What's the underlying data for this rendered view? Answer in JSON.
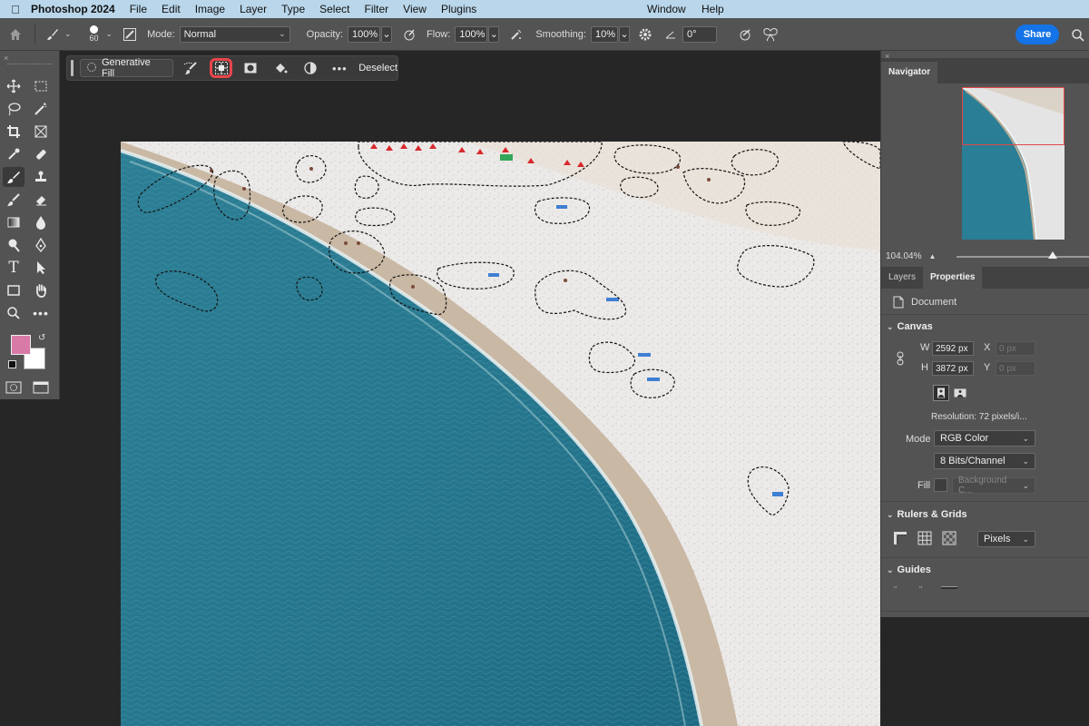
{
  "menubar": {
    "app_name": "Photoshop 2024",
    "menus": [
      "File",
      "Edit",
      "Image",
      "Layer",
      "Type",
      "Select",
      "Filter",
      "View",
      "Plugins"
    ],
    "right_menus": [
      "Window",
      "Help"
    ]
  },
  "options_bar": {
    "brush_size": "60",
    "mode_label": "Mode:",
    "mode_value": "Normal",
    "opacity_label": "Opacity:",
    "opacity_value": "100%",
    "flow_label": "Flow:",
    "flow_value": "100%",
    "smoothing_label": "Smoothing:",
    "smoothing_value": "10%",
    "angle_value": "0°",
    "share_label": "Share"
  },
  "task_bar": {
    "generative_fill_label": "Generative Fill",
    "deselect_label": "Deselect",
    "highlighted_tool": "select-subject-icon"
  },
  "tools": {
    "foreground_color": "#d87aa6",
    "background_color": "#ffffff"
  },
  "navigator": {
    "tab_label": "Navigator",
    "zoom": "104.04%",
    "zoom_fraction": 0.7
  },
  "properties": {
    "tabs": [
      "Layers",
      "Properties"
    ],
    "document_label": "Document",
    "canvas_section": "Canvas",
    "w_label": "W",
    "w_value": "2592 px",
    "h_label": "H",
    "h_value": "3872 px",
    "x_label": "X",
    "x_placeholder": "0 px",
    "y_label": "Y",
    "y_placeholder": "0 px",
    "resolution": "Resolution: 72 pixels/i...",
    "mode_label": "Mode",
    "mode_value": "RGB Color",
    "bits_value": "8 Bits/Channel",
    "fill_label": "Fill",
    "fill_value": "Background C...",
    "rulers_section": "Rulers & Grids",
    "units_value": "Pixels",
    "guides_section": "Guides"
  }
}
